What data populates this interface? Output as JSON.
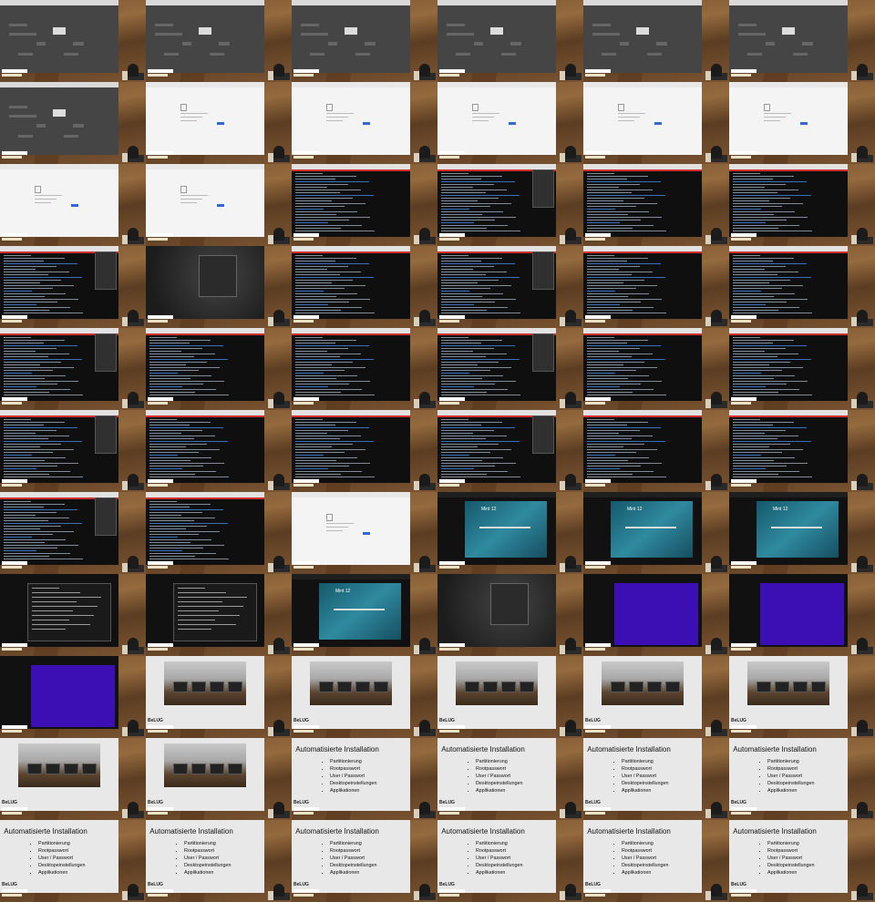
{
  "grid": {
    "columns": 6,
    "rows": 11
  },
  "slide": {
    "title": "Automatisierte Installation",
    "items": [
      "Partitionierung",
      "Rootpasswort",
      "User / Passwort",
      "Desktopeinstellungen",
      "Applikationen"
    ],
    "belug": "BeLUG"
  },
  "installer": {
    "title": "Mint 12"
  },
  "thumbnails": [
    "dark",
    "dark",
    "dark",
    "dark",
    "dark",
    "dark",
    "dark",
    "white",
    "white",
    "white",
    "white",
    "white",
    "white",
    "white",
    "term",
    "term",
    "term",
    "term",
    "term",
    "grey",
    "term",
    "term",
    "term",
    "term",
    "term",
    "term",
    "term",
    "term",
    "term",
    "term",
    "term",
    "term",
    "term",
    "term",
    "term",
    "term",
    "term",
    "term",
    "white",
    "inst",
    "inst",
    "inst",
    "console",
    "console",
    "inst",
    "grey2",
    "purple",
    "purple",
    "purple",
    "photo",
    "photo",
    "photo",
    "photo",
    "photo",
    "photo",
    "photo",
    "slide",
    "slide",
    "slide",
    "slide",
    "slide",
    "slide",
    "slide",
    "slide",
    "slide",
    "slide"
  ]
}
